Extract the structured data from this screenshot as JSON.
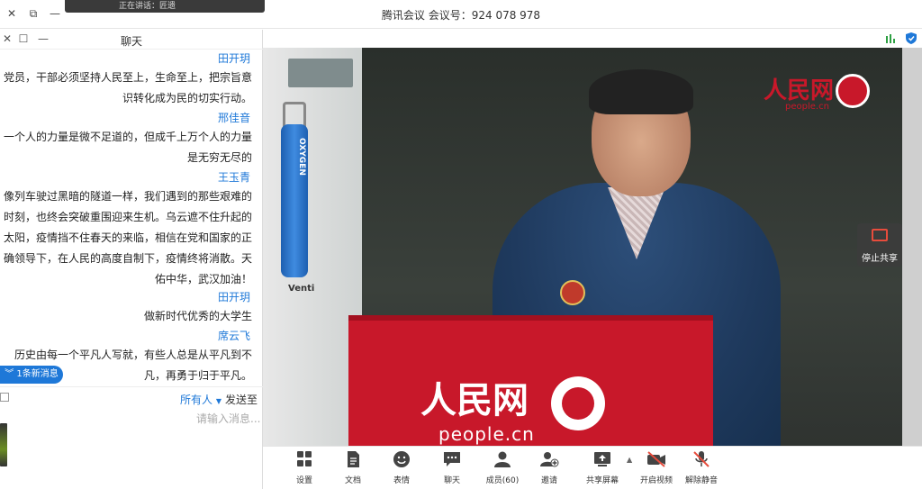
{
  "window": {
    "title": "腾讯会议 会议号：924 078 978",
    "toast": "正在讲话：匠遗"
  },
  "chat": {
    "title": "聊天",
    "messages": [
      {
        "name": "田开玥",
        "text": [
          "党员，干部必须坚持人民至上，生命至上，把宗旨意",
          "识转化成为民的切实行动。"
        ]
      },
      {
        "name": "邢佳音",
        "text": [
          "一个人的力量是微不足道的，但成千上万个人的力量",
          "是无穷无尽的"
        ]
      },
      {
        "name": "王玉青",
        "text": [
          "像列车驶过黑暗的隧道一样，我们遇到的那些艰难的",
          "时刻，也终会突破重围迎来生机。乌云遮不住升起的",
          "太阳，疫情挡不住春天的来临，相信在党和国家的正",
          "确领导下，在人民的高度自制下，疫情终将消散。天",
          "佑中华，武汉加油！"
        ]
      },
      {
        "name": "田开玥",
        "text": [
          "做新时代优秀的大学生"
        ]
      },
      {
        "name": "席云飞",
        "text": [
          "历史由每一个平凡人写就，有些人总是从平凡到不",
          "凡，再勇于归于平凡。"
        ]
      }
    ],
    "new_messages": "1条新消息",
    "send_to_label": "发送至",
    "send_to_target": "所有人",
    "input_placeholder": "请输入消息..."
  },
  "video": {
    "watermark_cn": "人民网",
    "watermark_en": "people.cn",
    "podium_cn": "人民网",
    "podium_en": "people.cn",
    "tank_label": "OXYGEN",
    "vent_text": "Venti",
    "stop_share": "停止共享"
  },
  "toolbar": {
    "items": [
      {
        "id": "unmute",
        "label": "解除静音",
        "icon": "mic-off-icon"
      },
      {
        "id": "video",
        "label": "开启视频",
        "icon": "camera-off-icon"
      },
      {
        "id": "share",
        "label": "共享屏幕",
        "icon": "share-screen-icon"
      },
      {
        "id": "invite",
        "label": "邀请",
        "icon": "invite-icon"
      },
      {
        "id": "members",
        "label": "成员(60)",
        "icon": "members-icon"
      },
      {
        "id": "chat",
        "label": "聊天",
        "icon": "chat-icon"
      },
      {
        "id": "emoji",
        "label": "表情",
        "icon": "emoji-icon"
      },
      {
        "id": "docs",
        "label": "文档",
        "icon": "document-icon"
      },
      {
        "id": "settings",
        "label": "设置",
        "icon": "settings-icon"
      }
    ]
  },
  "colors": {
    "accent": "#1e78d8",
    "brand_red": "#c8182a"
  }
}
